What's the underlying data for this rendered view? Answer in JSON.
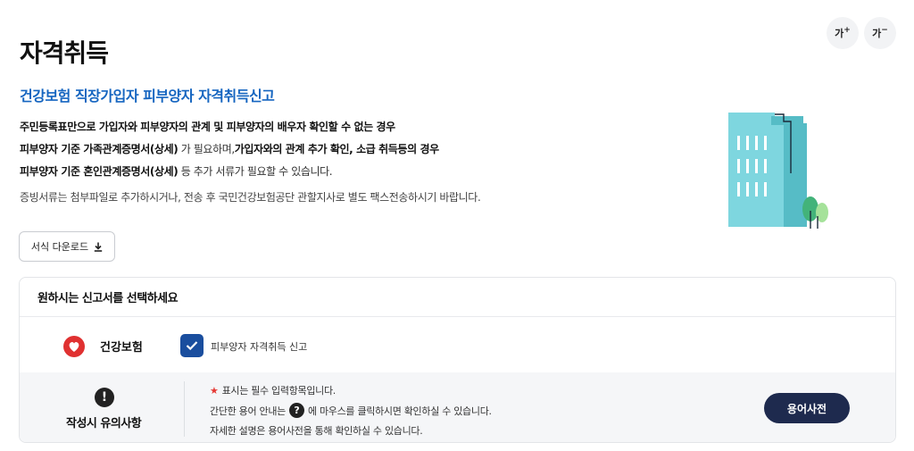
{
  "page": {
    "title": "자격취득",
    "subtitle": "건강보험 직장가입자 피부양자 자격취득신고"
  },
  "font_controls": {
    "increase_label": "가",
    "increase_mark": "+",
    "decrease_label": "가",
    "decrease_mark": "−"
  },
  "description": {
    "line1": "주민등록표만으로 가입자와 피부양자의 관계 및 피부양자의 배우자 확인할 수 없는 경우",
    "line2_bold1": "피부양자 기준 가족관계증명서(상세)",
    "line2_normal": " 가 필요하며,",
    "line2_bold2": "가입자와의 관계 추가 확인, 소급 취득등의 경우",
    "line3_bold": "피부양자 기준 혼인관계증명서(상세)",
    "line3_normal": " 등 추가 서류가 필요할 수 있습니다.",
    "line4": "증빙서류는 첨부파일로 추가하시거나, 전송 후 국민건강보험공단 관할지사로 별도 팩스전송하시기 바랍니다."
  },
  "download_button": {
    "label": "서식 다운로드",
    "icon": "download-icon"
  },
  "form_panel": {
    "heading": "원하시는 신고서를 선택하세요",
    "brand": {
      "icon": "nhis-logo-icon",
      "name": "건강보험"
    },
    "option": {
      "checked": true,
      "label": "피부양자 자격취득 신고"
    }
  },
  "notes": {
    "icon": "exclamation-icon",
    "title": "작성시 유의사항",
    "required_mark": "★",
    "line1": "표시는 필수 입력항목입니다.",
    "line2_before": "간단한 용어 안내는",
    "help_icon": "?",
    "line2_after": "에 마우스를 클릭하시면 확인하실 수 있습니다.",
    "line3": "자세한 설명은 용어사전을 통해 확인하실 수 있습니다.",
    "glossary_button": "용어사전"
  },
  "colors": {
    "accent_blue": "#1565c0",
    "checkbox_blue": "#1a4e9e",
    "glossary_navy": "#1e2a4e",
    "required_red": "#e53935",
    "brand_red": "#e03131"
  }
}
